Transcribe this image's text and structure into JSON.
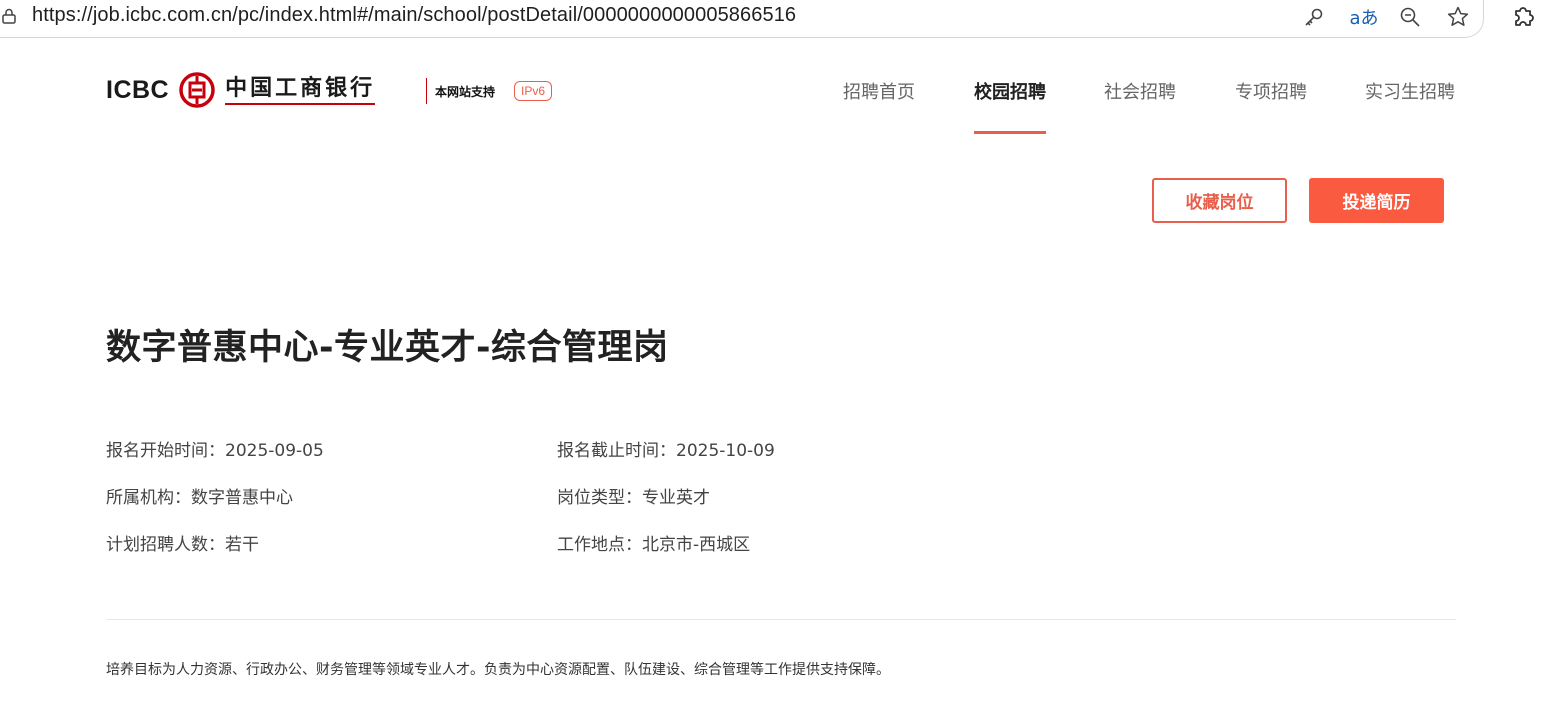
{
  "browser": {
    "url": "https://job.icbc.com.cn/pc/index.html#/main/school/postDetail/0000000000005866516",
    "icons": [
      "lock-icon",
      "key-icon",
      "read-aloud-icon",
      "zoom-out-icon",
      "favorite-star-icon",
      "extensions-icon"
    ],
    "read_aloud_label": "aあ"
  },
  "header": {
    "logo_en": "ICBC",
    "logo_cn": "中国工商银行",
    "ipv6_text": "本网站支持",
    "ipv6_badge": "IPv6",
    "nav": [
      {
        "label": "招聘首页",
        "active": false
      },
      {
        "label": "校园招聘",
        "active": true
      },
      {
        "label": "社会招聘",
        "active": false
      },
      {
        "label": "专项招聘",
        "active": false
      },
      {
        "label": "实习生招聘",
        "active": false
      }
    ]
  },
  "actions": {
    "favorite_label": "收藏岗位",
    "apply_label": "投递简历"
  },
  "job": {
    "title": "数字普惠中心-专业英才-综合管理岗",
    "info": {
      "start_time": "报名开始时间：2025-09-05",
      "end_time": "报名截止时间：2025-10-09",
      "institution": "所属机构：数字普惠中心",
      "post_type": "岗位类型：专业英才",
      "headcount": "计划招聘人数：若干",
      "location": "工作地点：北京市-西城区"
    },
    "description": "培养目标为人力资源、行政办公、财务管理等领域专业人才。负责为中心资源配置、队伍建设、综合管理等工作提供支持保障。"
  },
  "colors": {
    "accent": "#e8604c",
    "apply_button": "#fa5a40",
    "brand_red": "#c7000b"
  }
}
